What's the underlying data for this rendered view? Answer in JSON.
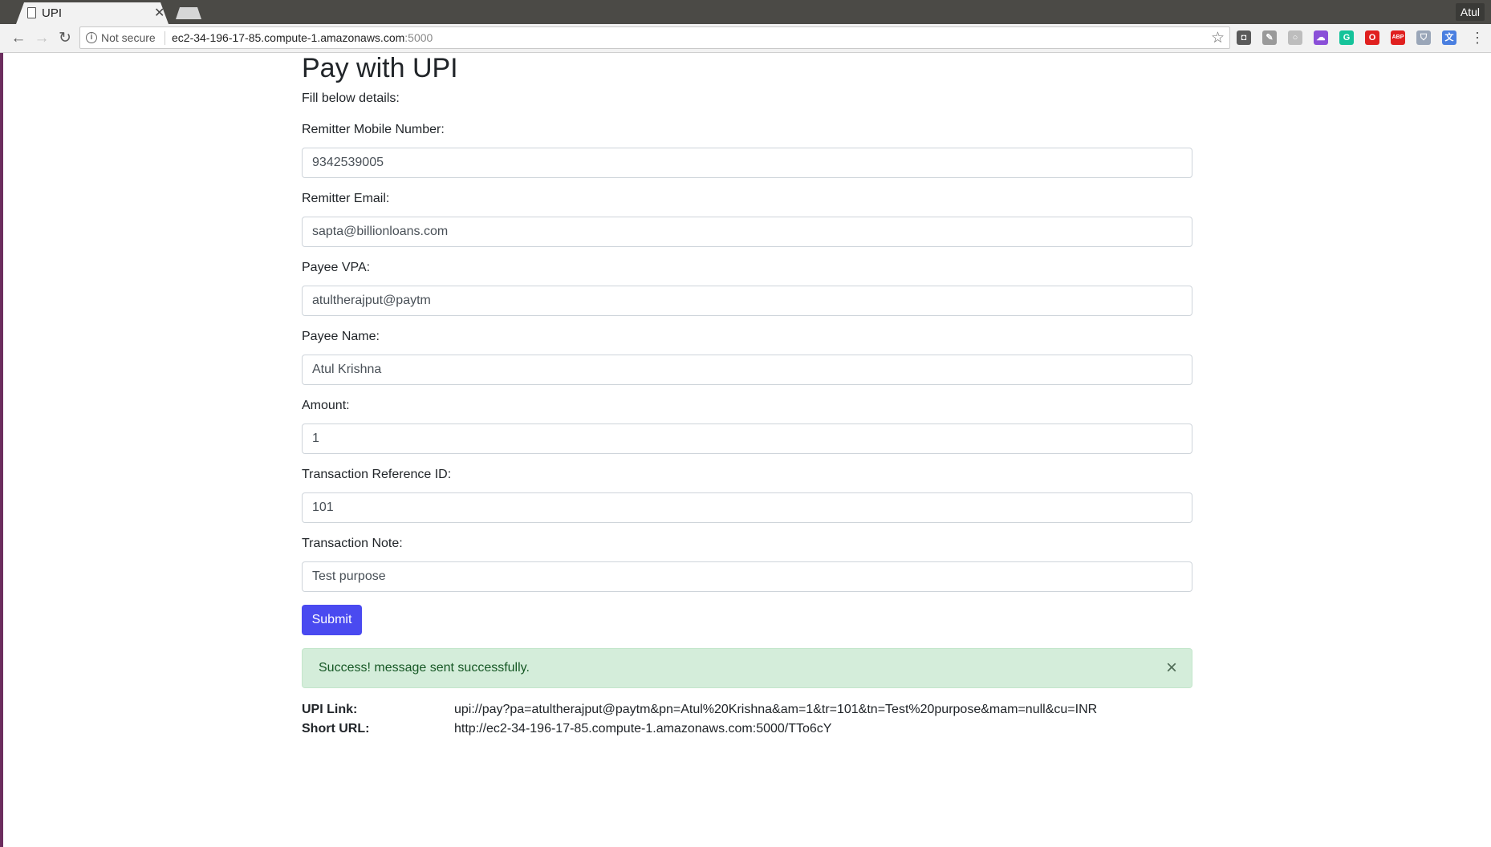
{
  "browser": {
    "tab_title": "UPI",
    "profile_name": "Atul",
    "security_label": "Not secure",
    "url_host": "ec2-34-196-17-85.compute-1.amazonaws.com",
    "url_port": ":5000"
  },
  "extensions": [
    {
      "name": "pocket-icon",
      "color": "#5a5a5a",
      "glyph": "◘"
    },
    {
      "name": "pen-icon",
      "color": "#9a9a9a",
      "glyph": "✎"
    },
    {
      "name": "circle-ext-icon",
      "color": "#bdbdbd",
      "glyph": "○"
    },
    {
      "name": "cloud-icon",
      "color": "#8a4fd8",
      "glyph": "☁"
    },
    {
      "name": "grammarly-icon",
      "color": "#15c39a",
      "glyph": "G"
    },
    {
      "name": "opera-icon",
      "color": "#e0201f",
      "glyph": "O"
    },
    {
      "name": "adblock-icon",
      "color": "#e0201f",
      "glyph": "ABP"
    },
    {
      "name": "shield-icon",
      "color": "#9aa6b8",
      "glyph": "⛉"
    },
    {
      "name": "translate-icon",
      "color": "#4a7fe0",
      "glyph": "文"
    }
  ],
  "page": {
    "title": "Pay with UPI",
    "intro": "Fill below details:",
    "fields": [
      {
        "label": "Remitter Mobile Number:",
        "value": "9342539005"
      },
      {
        "label": "Remitter Email:",
        "value": "sapta@billionloans.com"
      },
      {
        "label": "Payee VPA:",
        "value": "atultherajput@paytm"
      },
      {
        "label": "Payee Name:",
        "value": "Atul Krishna"
      },
      {
        "label": "Amount:",
        "value": "1"
      },
      {
        "label": "Transaction Reference ID:",
        "value": "101"
      },
      {
        "label": "Transaction Note:",
        "value": "Test purpose"
      }
    ],
    "submit_label": "Submit",
    "alert_text": "Success! message sent successfully.",
    "alert_close": "×",
    "upi_link_label": "UPI Link:",
    "upi_link_value": "upi://pay?pa=atultherajput@paytm&pn=Atul%20Krishna&am=1&tr=101&tn=Test%20purpose&mam=null&cu=INR",
    "short_url_label": "Short URL:",
    "short_url_value": "http://ec2-34-196-17-85.compute-1.amazonaws.com:5000/TTo6cY"
  },
  "colors": {
    "submit_bg": "#4a4af0",
    "alert_bg": "#d4edda",
    "alert_text": "#155724"
  }
}
